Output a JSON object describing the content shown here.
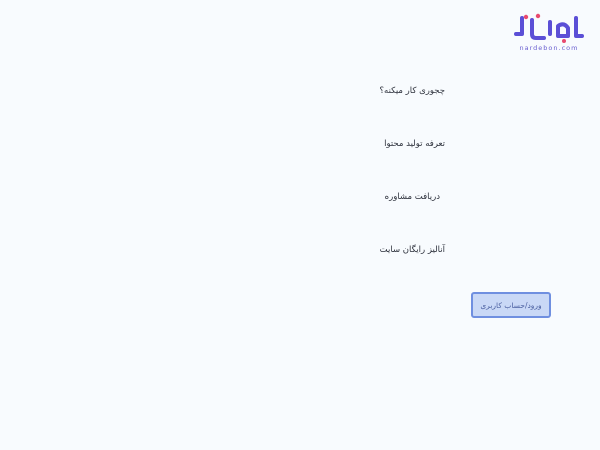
{
  "brand": {
    "logo_text": "نردبون",
    "tagline": "nardebon.com",
    "colors": {
      "primary": "#5b4fd6",
      "accent": "#e84a6f"
    }
  },
  "nav": {
    "items": [
      {
        "label": "چجوری کار میکنه؟"
      },
      {
        "label": "تعرفه تولید محتوا"
      },
      {
        "label": "دریافت مشاوره"
      },
      {
        "label": "آنالیز رایگان سایت"
      }
    ]
  },
  "auth": {
    "login_label": "ورود/حساب کاربری"
  }
}
